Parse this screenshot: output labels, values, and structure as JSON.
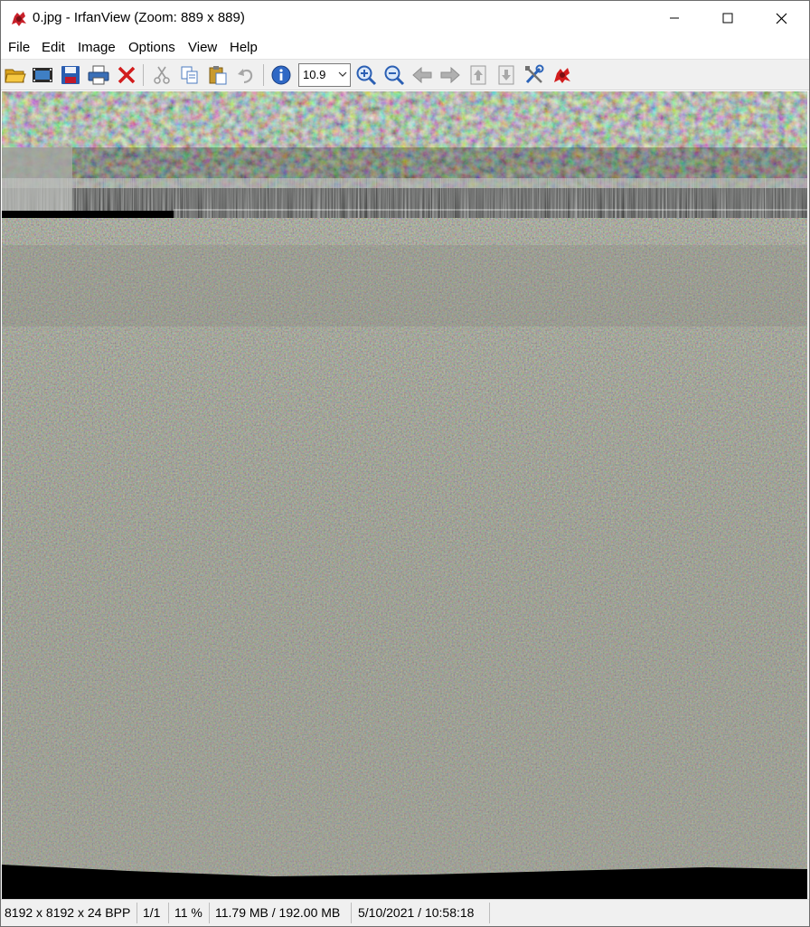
{
  "window": {
    "title": "0.jpg - IrfanView (Zoom: 889 x 889)",
    "controls": {
      "minimize": "minimize-icon",
      "maximize": "maximize-icon",
      "close": "close-icon"
    }
  },
  "menu": [
    "File",
    "Edit",
    "Image",
    "Options",
    "View",
    "Help"
  ],
  "toolbar": {
    "buttons": [
      "open-folder-icon",
      "slideshow-icon",
      "save-icon",
      "print-icon",
      "delete-icon",
      "cut-icon",
      "copy-icon",
      "paste-icon",
      "undo-icon",
      "info-icon",
      "zoom-in-icon",
      "zoom-out-icon",
      "previous-icon",
      "next-icon",
      "first-file-icon",
      "last-file-icon",
      "properties-icon",
      "irfanview-logo-icon"
    ],
    "zoom_value": "10.9"
  },
  "image": {
    "description_colors": {
      "background": "#000000",
      "texture_dark": "#3d4038",
      "texture_light": "#9a9c94"
    }
  },
  "status": {
    "dimensions": "8192 x 8192 x 24 BPP",
    "page": "1/1",
    "zoom": "11 %",
    "memory": "11.79 MB / 192.00 MB",
    "datetime": "5/10/2021 / 10:58:18"
  }
}
